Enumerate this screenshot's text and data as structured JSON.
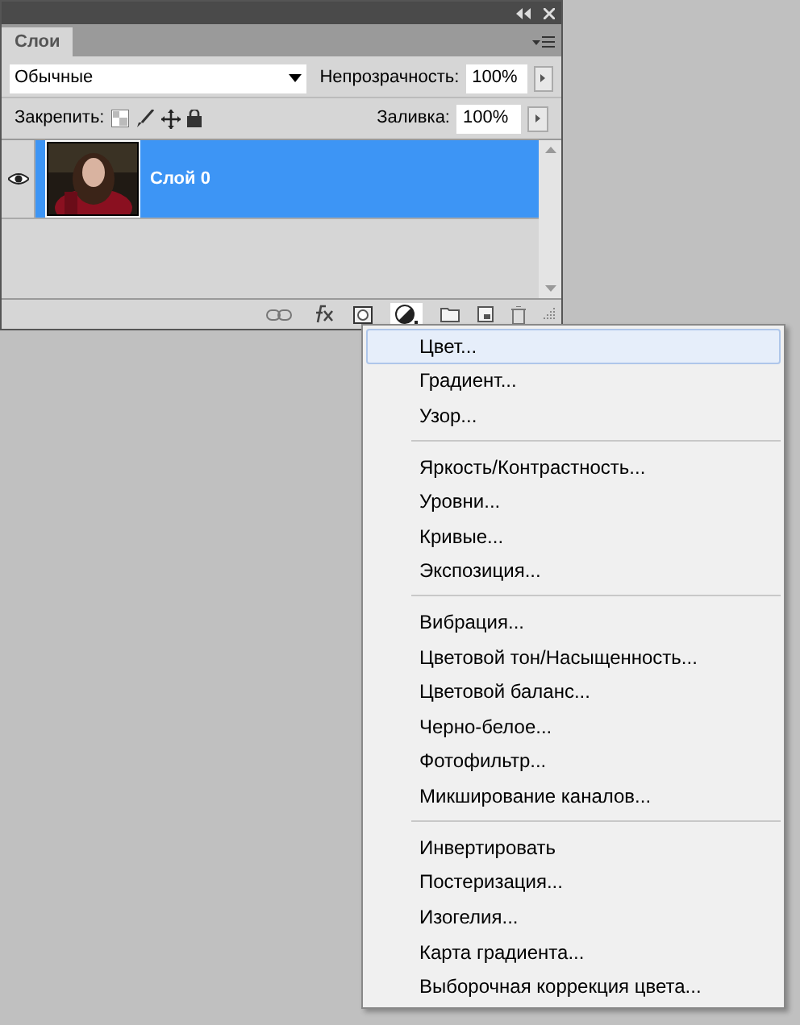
{
  "panel": {
    "tab": "Слои",
    "blend_mode": "Обычные",
    "opacity_label": "Непрозрачность:",
    "opacity": "100%",
    "lock_label": "Закрепить:",
    "fill_label": "Заливка:",
    "fill": "100%"
  },
  "layers": [
    {
      "name": "Слой 0",
      "visible": true,
      "selected": true
    }
  ],
  "menu": {
    "groups": [
      [
        {
          "label": "Цвет...",
          "selected": true
        },
        {
          "label": "Градиент...",
          "selected": false
        },
        {
          "label": "Узор...",
          "selected": false
        }
      ],
      [
        {
          "label": "Яркость/Контрастность...",
          "selected": false
        },
        {
          "label": "Уровни...",
          "selected": false
        },
        {
          "label": "Кривые...",
          "selected": false
        },
        {
          "label": "Экспозиция...",
          "selected": false
        }
      ],
      [
        {
          "label": "Вибрация...",
          "selected": false
        },
        {
          "label": "Цветовой тон/Насыщенность...",
          "selected": false
        },
        {
          "label": "Цветовой баланс...",
          "selected": false
        },
        {
          "label": "Черно-белое...",
          "selected": false
        },
        {
          "label": "Фотофильтр...",
          "selected": false
        },
        {
          "label": "Микширование каналов...",
          "selected": false
        }
      ],
      [
        {
          "label": "Инвертировать",
          "selected": false
        },
        {
          "label": "Постеризация...",
          "selected": false
        },
        {
          "label": "Изогелия...",
          "selected": false
        },
        {
          "label": "Карта градиента...",
          "selected": false
        },
        {
          "label": "Выборочная коррекция цвета...",
          "selected": false
        }
      ]
    ]
  }
}
